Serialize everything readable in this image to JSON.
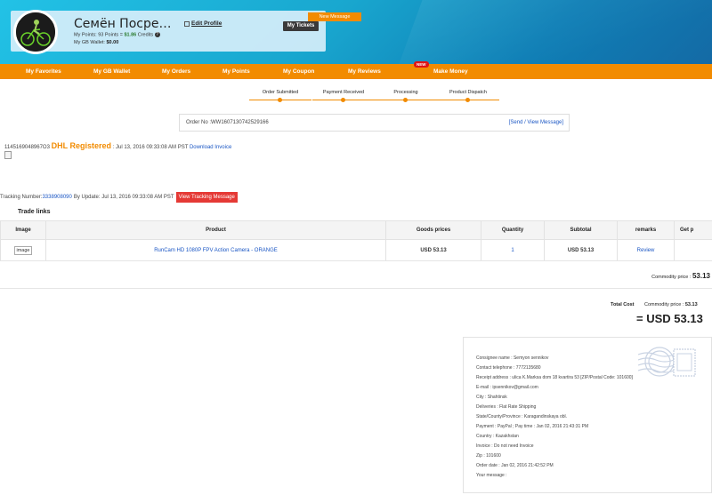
{
  "profile": {
    "name": "Семён Посредн…",
    "edit_profile": "Edit Profile",
    "points_prefix": "My Points:",
    "points_value": "93 Points",
    "points_equals": "=",
    "points_money": "$1.86",
    "credits_label": "Credits",
    "wallet_label": "My GB Wallet:",
    "wallet_value": "$0.00",
    "my_tickets": "My Tickets",
    "new_message": "New Message"
  },
  "nav": {
    "items": [
      "My Favorites",
      "My GB Wallet",
      "My Orders",
      "My Points",
      "My Coupon",
      "My Reviews",
      "Make Money"
    ],
    "badge": "NEW"
  },
  "steps": [
    "Order Submitted",
    "Payment Received",
    "Processing",
    "Product Dispatch"
  ],
  "order": {
    "order_no": "Order No :WW1607130742529166",
    "send_view": "[Send / View Message]"
  },
  "shipping": {
    "ref": "1145169048967O3",
    "carrier": "DHL Registered",
    "date": ": Jul 13, 2016 09:33:08 AM PST",
    "download_invoice": "Download Invoice"
  },
  "tracking": {
    "label": "Tracking Number:",
    "number": "3338908090",
    "update": "By Update: Jul 13, 2016 09:33:08 AM PST",
    "button": "View Tracking Message"
  },
  "trade_links": "Trade links",
  "table": {
    "headers": [
      "Image",
      "Product",
      "Goods prices",
      "Quantity",
      "Subtotal",
      "remarks",
      "Get p"
    ],
    "row": {
      "image": "image",
      "product": "RunCam HD 1080P FPV Action Camera - ORANGE",
      "price": "USD 53.13",
      "quantity": "1",
      "subtotal": "USD 53.13",
      "remarks": "Review"
    }
  },
  "totals": {
    "commodity_label": "Commodity price :",
    "commodity_value": "53.13",
    "total_cost": "Total Cost",
    "commodity_label2": "Commodity price :",
    "commodity_value2": "53.13",
    "grand": "= USD 53.13"
  },
  "consignee": [
    "Consignee name : Semyon sennikov",
    "Contact telephone : 7772135680",
    "Receipt address : ulica K.Marksa dom 18 kvartira 53 [ZIP/Postal Code: 101600]",
    "E-mail : ipsennikov@gmail.com",
    "City : Shahtinsk",
    "Deliveries : Flat Rate Shipping",
    "State/County/Province : Karagandinskaya obl.",
    "Payment : PayPal ; Pay time : Jan 02, 2016 21:43:31 PM",
    "Country : Kazakhstan",
    "Invoice : Do not need Invoice",
    "Zip : 101600",
    "Order date : Jan 02, 2016 21:42:52 PM",
    "Your message :"
  ],
  "colors": {
    "accent": "#f28b00",
    "link": "#1a56c4",
    "danger": "#e53935"
  }
}
